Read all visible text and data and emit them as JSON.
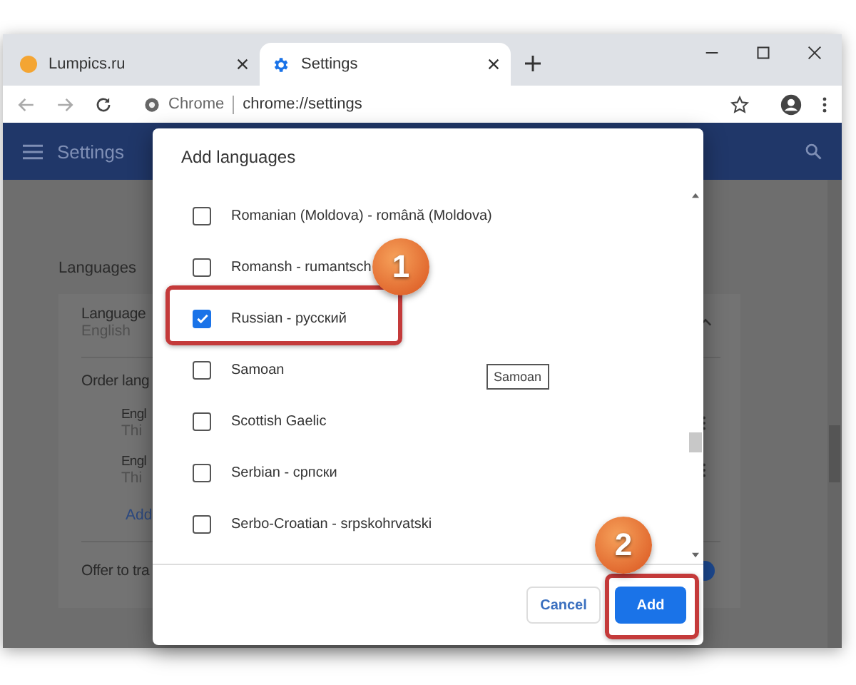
{
  "tabs": [
    {
      "title": "Lumpics.ru",
      "selected": false
    },
    {
      "title": "Settings",
      "selected": true
    }
  ],
  "address_bar": {
    "origin_label": "Chrome",
    "url": "chrome://settings"
  },
  "settings_header": {
    "title": "Settings"
  },
  "page": {
    "section_title": "Languages",
    "language_label": "Language",
    "language_value": "English",
    "order_label": "Order lang",
    "languages": [
      {
        "name": "Engl",
        "note": "Thi"
      },
      {
        "name": "Engl",
        "note": "Thi"
      }
    ],
    "add_link": "Add",
    "offer_label": "Offer to tra",
    "offer_toggle_on": true
  },
  "dialog": {
    "title": "Add languages",
    "items": [
      {
        "label": "Romanian (Moldova) - română (Moldova)",
        "checked": false
      },
      {
        "label": "Romansh - rumantsch",
        "checked": false
      },
      {
        "label": "Russian - русский",
        "checked": true
      },
      {
        "label": "Samoan",
        "checked": false
      },
      {
        "label": "Scottish Gaelic",
        "checked": false
      },
      {
        "label": "Serbian - српски",
        "checked": false
      },
      {
        "label": "Serbo-Croatian - srpskohrvatski",
        "checked": false
      }
    ],
    "tooltip": "Samoan",
    "buttons": [
      {
        "label": "Cancel",
        "kind": "secondary"
      },
      {
        "label": "Add",
        "kind": "primary"
      }
    ]
  },
  "callouts": [
    {
      "number": "1"
    },
    {
      "number": "2"
    }
  ]
}
